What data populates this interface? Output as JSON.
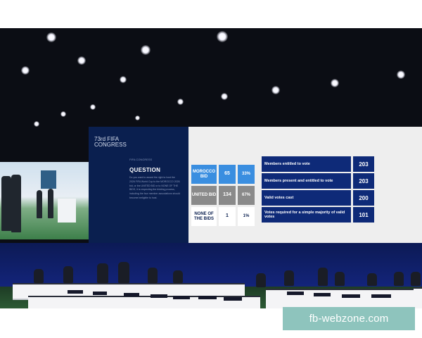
{
  "screen": {
    "congress_logo": "73rd FIFA CONGRESS",
    "question_tag": "FIFA CONGRESS",
    "question_title": "QUESTION",
    "question_text": "Do you want to award the right to host the 2026 FIFA World Cup to the MOROCCO 2026 bid, or the UNITED BID or to NONE OF THE BIDS, it is respecting the bidding process, including the four member associations should become ineligible to host.",
    "bids": [
      {
        "name": "MOROCCO BID",
        "votes": "65",
        "pct": "33%",
        "color": "#3a8ee0"
      },
      {
        "name": "UNITED BID",
        "votes": "134",
        "pct": "67%",
        "color": "#8a8a8a"
      },
      {
        "name": "NONE OF THE BIDS",
        "votes": "1",
        "pct": "1%",
        "color": "#ffffff"
      }
    ],
    "stats": [
      {
        "label": "Members entitled to vote",
        "value": "203"
      },
      {
        "label": "Members present and entitled to vote",
        "value": "203"
      },
      {
        "label": "Valid votes cast",
        "value": "200"
      },
      {
        "label": "Votes required for a simple majority of valid votes",
        "value": "101"
      }
    ]
  },
  "watermark": "fb-webzone.com",
  "colors": {
    "screen_navy": "#0a1f4f",
    "stat_blue": "#0e2a78",
    "wall_blue": "#13247a",
    "watermark_bg": "#8ec4bd"
  }
}
